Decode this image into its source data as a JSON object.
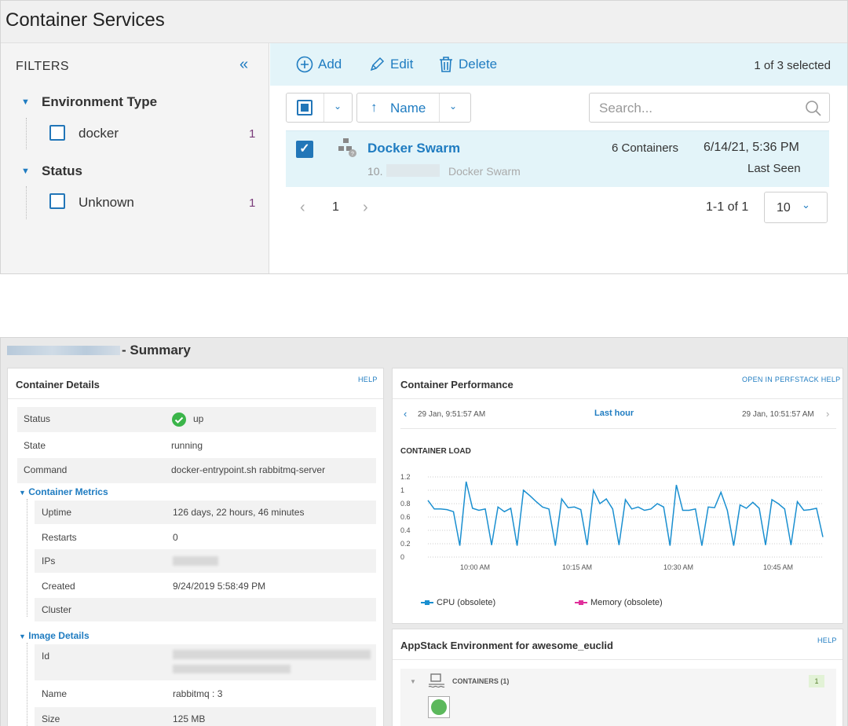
{
  "top": {
    "title": "Container Services",
    "filters": {
      "title": "FILTERS",
      "collapse": "«",
      "groups": [
        {
          "title": "Environment Type",
          "items": [
            {
              "label": "docker",
              "count": "1"
            }
          ]
        },
        {
          "title": "Status",
          "items": [
            {
              "label": "Unknown",
              "count": "1"
            }
          ]
        }
      ]
    },
    "toolbar": {
      "add": "Add",
      "edit": "Edit",
      "delete": "Delete",
      "selected": "1 of 3 selected"
    },
    "sort": {
      "label": "Name"
    },
    "search": {
      "placeholder": "Search..."
    },
    "row": {
      "name": "Docker Swarm",
      "ip_prefix": "10.",
      "type": "Docker Swarm",
      "containers": "6 Containers",
      "date": "6/14/21, 5:36 PM",
      "last_seen": "Last Seen"
    },
    "pager": {
      "prev": "‹",
      "page": "1",
      "next": "›",
      "range": "1-1 of 1",
      "per_page": "10"
    }
  },
  "bottom": {
    "summary_title": "- Summary",
    "details": {
      "title": "Container Details",
      "help": "HELP",
      "rows": [
        {
          "key": "Status",
          "value": "up"
        },
        {
          "key": "State",
          "value": "running"
        },
        {
          "key": "Command",
          "value": "docker-entrypoint.sh rabbitmq-server"
        }
      ],
      "metrics_title": "Container Metrics",
      "metrics": [
        {
          "key": "Uptime",
          "value": "126 days, 22 hours, 46 minutes"
        },
        {
          "key": "Restarts",
          "value": "0"
        },
        {
          "key": "IPs",
          "value": ""
        },
        {
          "key": "Created",
          "value": "9/24/2019 5:58:49 PM"
        },
        {
          "key": "Cluster",
          "value": ""
        }
      ],
      "image_title": "Image Details",
      "image": [
        {
          "key": "Id",
          "value": ""
        },
        {
          "key": "Name",
          "value": "rabbitmq : 3"
        },
        {
          "key": "Size",
          "value": "125 MB"
        }
      ]
    },
    "performance": {
      "title": "Container Performance",
      "links": "OPEN IN PERFSTACK  HELP",
      "range_start": "29 Jan, 9:51:57 AM",
      "range_label": "Last hour",
      "range_end": "29 Jan, 10:51:57 AM",
      "chart_title": "CONTAINER LOAD"
    },
    "appstack": {
      "title": "AppStack Environment for awesome_euclid",
      "help": "HELP",
      "containers_label": "CONTAINERS (1)",
      "count": "1",
      "status_color": "#5cb85c"
    }
  },
  "chart_data": {
    "type": "line",
    "title": "CONTAINER LOAD",
    "ylim": [
      0,
      1.2
    ],
    "yticks": [
      "1.2",
      "1",
      "0.8",
      "0.6",
      "0.4",
      "0.2",
      "0"
    ],
    "xticks": [
      "10:00 AM",
      "10:15 AM",
      "10:30 AM",
      "10:45 AM"
    ],
    "series": [
      {
        "name": "CPU (obsolete)",
        "color": "#1a8fd0",
        "values": [
          0.85,
          0.72,
          0.72,
          0.71,
          0.68,
          0.17,
          1.13,
          0.73,
          0.7,
          0.72,
          0.18,
          0.75,
          0.68,
          0.73,
          0.17,
          1.0,
          0.92,
          0.83,
          0.75,
          0.72,
          0.17,
          0.87,
          0.74,
          0.75,
          0.71,
          0.18,
          1.0,
          0.8,
          0.87,
          0.72,
          0.18,
          0.86,
          0.72,
          0.75,
          0.7,
          0.72,
          0.8,
          0.75,
          0.17,
          1.08,
          0.7,
          0.7,
          0.72,
          0.17,
          0.75,
          0.74,
          0.97,
          0.7,
          0.17,
          0.78,
          0.73,
          0.82,
          0.73,
          0.18,
          0.86,
          0.8,
          0.72,
          0.18,
          0.83,
          0.7,
          0.71,
          0.73,
          0.3
        ]
      },
      {
        "name": "Memory (obsolete)",
        "color": "#e0309b",
        "values": []
      }
    ]
  }
}
